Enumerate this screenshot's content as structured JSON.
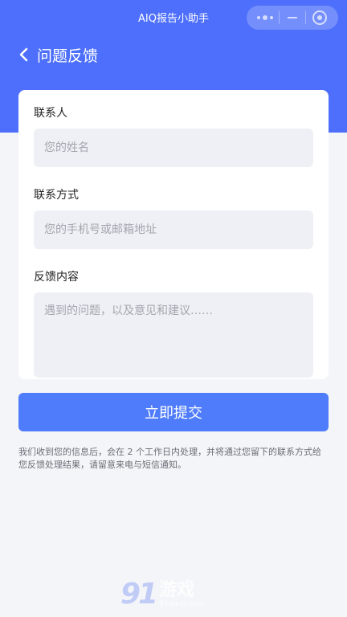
{
  "app": {
    "title": "AIQ报告小助手"
  },
  "nav": {
    "back_icon": "chevron-left-icon",
    "title": "问题反馈"
  },
  "capsule": {
    "more_icon": "more-dots-icon",
    "minimize_icon": "minus-icon",
    "close_icon": "target-icon"
  },
  "form": {
    "contact_label": "联系人",
    "contact_placeholder": "您的姓名",
    "contact_value": "",
    "method_label": "联系方式",
    "method_placeholder": "您的手机号或邮箱地址",
    "method_value": "",
    "content_label": "反馈内容",
    "content_placeholder": "遇到的问题，以及意见和建议……",
    "content_value": ""
  },
  "submit_label": "立即提交",
  "notice": "我们收到您的信息后，会在 2 个工作日内处理，并将通过您留下的联系方式给您反馈处理结果，请留意来电与短信通知。",
  "watermark": {
    "num": "91",
    "name": "游戏",
    "url": "91danji.com"
  },
  "colors": {
    "primary": "#4d6ffb",
    "button": "#4f7cfb",
    "input_bg": "#eff0f5",
    "page_bg": "#f4f5f9"
  }
}
